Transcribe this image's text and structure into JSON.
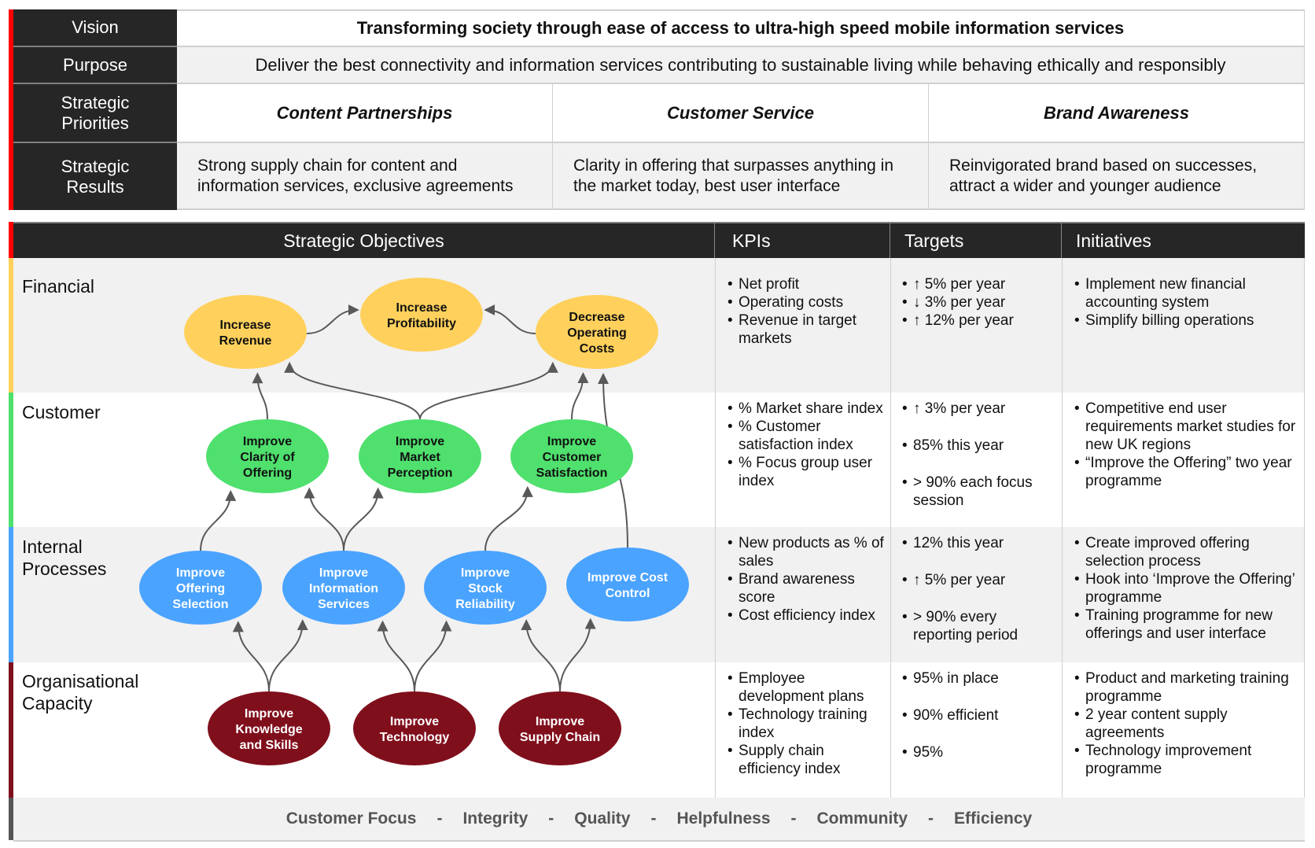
{
  "top": {
    "vision": {
      "label": "Vision",
      "text": "Transforming society through ease of access to ultra-high speed mobile information services"
    },
    "purpose": {
      "label": "Purpose",
      "text": "Deliver the best connectivity and information services contributing to sustainable living while behaving ethically and responsibly"
    },
    "priorities": {
      "label_line1": "Strategic",
      "label_line2": "Priorities",
      "items": [
        "Content Partnerships",
        "Customer Service",
        "Brand Awareness"
      ]
    },
    "results": {
      "label_line1": "Strategic",
      "label_line2": "Results",
      "items": [
        {
          "line1": "Strong supply chain for content and",
          "line2": "information services, exclusive agreements"
        },
        {
          "line1": "Clarity in offering that surpasses anything in",
          "line2": "the market today, best user interface"
        },
        {
          "line1": "Reinvigorated brand based on successes,",
          "line2": "attract a wider and younger audience"
        }
      ]
    }
  },
  "table": {
    "headers": {
      "objectives": "Strategic Objectives",
      "kpis": "KPIs",
      "targets": "Targets",
      "initiatives": "Initiatives"
    },
    "rows": [
      {
        "label_line1": "Financial",
        "label_line2": "",
        "kpis": [
          "Net profit",
          "Operating costs",
          "Revenue in target markets"
        ],
        "targets": [
          "↑ 5% per year",
          "↓ 3% per year",
          "↑ 12% per year"
        ],
        "initiatives": [
          "Implement new financial accounting system",
          "Simplify billing operations"
        ]
      },
      {
        "label_line1": "Customer",
        "label_line2": "",
        "kpis": [
          "% Market share index",
          "% Customer satisfaction index",
          "% Focus group user index"
        ],
        "targets": [
          "↑ 3% per year",
          "85% this year",
          "> 90% each focus session"
        ],
        "initiatives": [
          "Competitive end user requirements market studies for new UK regions",
          "“Improve the Offering” two year programme"
        ]
      },
      {
        "label_line1": "Internal",
        "label_line2": "Processes",
        "kpis": [
          "New products as % of sales",
          "Brand awareness score",
          "Cost efficiency index"
        ],
        "targets": [
          "12% this year",
          "↑ 5% per year",
          "> 90% every reporting period"
        ],
        "initiatives": [
          "Create improved offering selection process",
          "Hook into ‘Improve the Offering’ programme",
          "Training programme for new offerings and user interface"
        ]
      },
      {
        "label_line1": "Organisational",
        "label_line2": "Capacity",
        "kpis": [
          "Employee development plans",
          "Technology training index",
          "Supply chain efficiency index"
        ],
        "targets": [
          "95% in place",
          "90% efficient",
          "95%"
        ],
        "initiatives": [
          "Product and marketing training programme",
          "2 year content supply agreements",
          "Technology improvement programme"
        ]
      }
    ]
  },
  "colors": {
    "financial": "#FFD15C",
    "customer": "#4FE06E",
    "internal": "#4AA3FF",
    "organisational": "#800F1C",
    "accent": "#FF0000",
    "values_bar": "#555555",
    "arrow": "#595959"
  },
  "nodes": [
    {
      "id": "rev",
      "lines": [
        "Increase",
        "Revenue"
      ],
      "group": "financial"
    },
    {
      "id": "prof",
      "lines": [
        "Increase",
        "Profitability"
      ],
      "group": "financial"
    },
    {
      "id": "cost",
      "lines": [
        "Decrease",
        "Operating",
        "Costs"
      ],
      "group": "financial"
    },
    {
      "id": "clar",
      "lines": [
        "Improve",
        "Clarity of",
        "Offering"
      ],
      "group": "customer"
    },
    {
      "id": "mkt",
      "lines": [
        "Improve",
        "Market",
        "Perception"
      ],
      "group": "customer"
    },
    {
      "id": "csat",
      "lines": [
        "Improve",
        "Customer",
        "Satisfaction"
      ],
      "group": "customer"
    },
    {
      "id": "offs",
      "lines": [
        "Improve",
        "Offering",
        "Selection"
      ],
      "group": "internal"
    },
    {
      "id": "info",
      "lines": [
        "Improve",
        "Information",
        "Services"
      ],
      "group": "internal"
    },
    {
      "id": "stock",
      "lines": [
        "Improve",
        "Stock",
        "Reliability"
      ],
      "group": "internal"
    },
    {
      "id": "cctl",
      "lines": [
        "Improve Cost",
        "Control"
      ],
      "group": "internal"
    },
    {
      "id": "know",
      "lines": [
        "Improve",
        "Knowledge",
        "and Skills"
      ],
      "group": "organisational"
    },
    {
      "id": "tech",
      "lines": [
        "Improve",
        "Technology"
      ],
      "group": "organisational"
    },
    {
      "id": "supp",
      "lines": [
        "Improve",
        "Supply Chain"
      ],
      "group": "organisational"
    }
  ],
  "edges": [
    [
      "rev",
      "prof"
    ],
    [
      "cost",
      "prof"
    ],
    [
      "clar",
      "rev"
    ],
    [
      "mkt",
      "rev"
    ],
    [
      "mkt",
      "cost"
    ],
    [
      "csat",
      "cost"
    ],
    [
      "cctl",
      "cost"
    ],
    [
      "offs",
      "clar"
    ],
    [
      "info",
      "clar"
    ],
    [
      "info",
      "mkt"
    ],
    [
      "stock",
      "csat"
    ],
    [
      "know",
      "offs"
    ],
    [
      "know",
      "info"
    ],
    [
      "tech",
      "info"
    ],
    [
      "tech",
      "stock"
    ],
    [
      "supp",
      "stock"
    ],
    [
      "supp",
      "cctl"
    ]
  ],
  "values": [
    "Customer Focus",
    "Integrity",
    "Quality",
    "Helpfulness",
    "Community",
    "Efficiency"
  ],
  "values_separator": "-"
}
